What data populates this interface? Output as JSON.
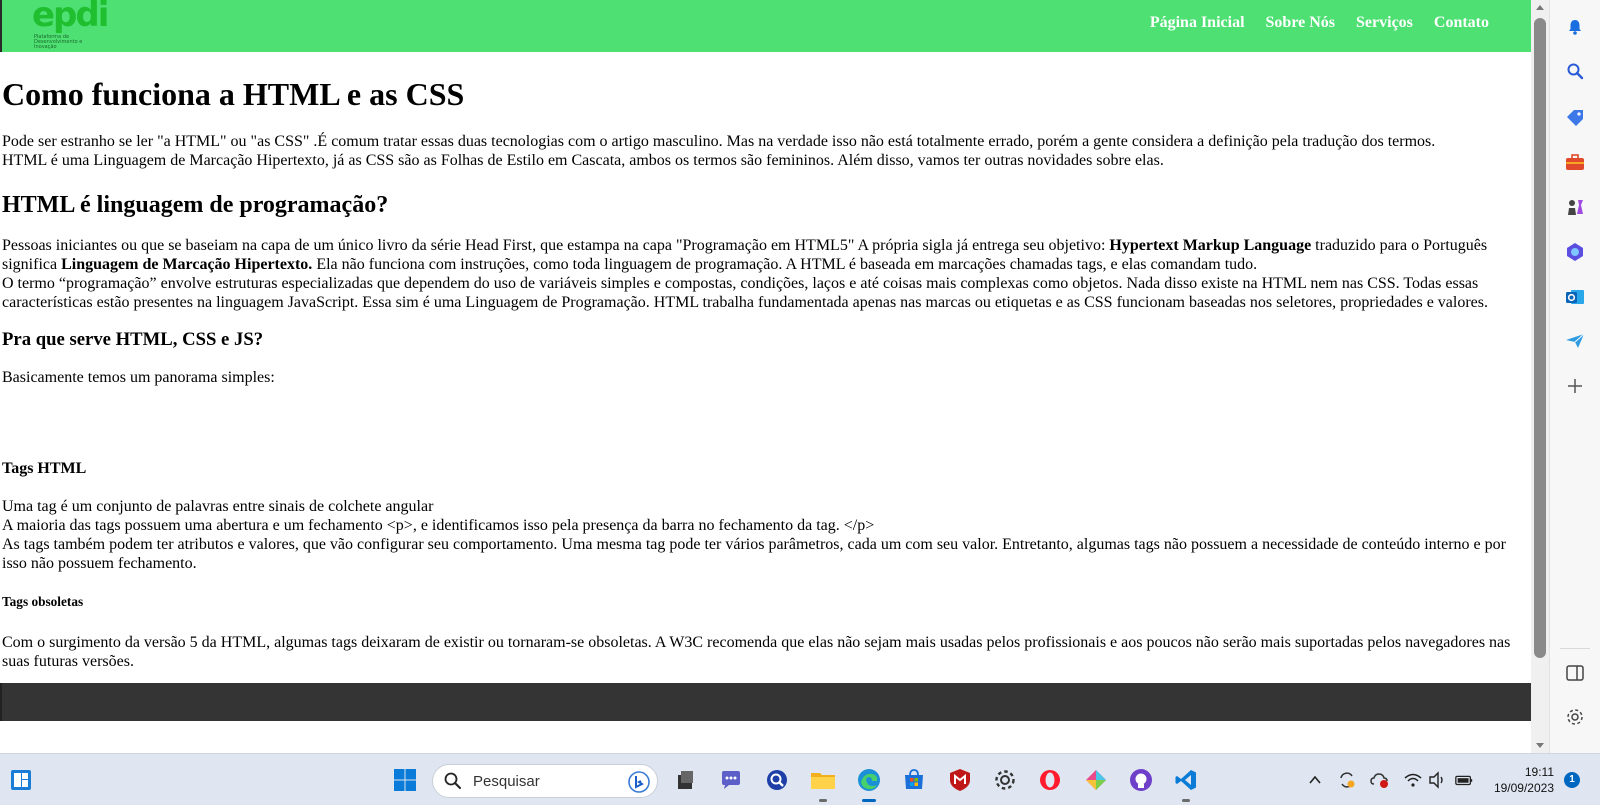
{
  "site": {
    "logo_text": "epdi",
    "logo_subtext": "Plataforma de Desenvolvimento e Inovação",
    "nav": [
      "Página Inicial",
      "Sobre Nós",
      "Serviços",
      "Contato"
    ]
  },
  "article": {
    "h1": "Como funciona a HTML e as CSS",
    "intro": [
      "Pode ser estranho se ler \"a HTML\" ou \"as CSS\" .É comum tratar essas duas tecnologias com o artigo masculino. Mas na verdade isso não está totalmente errado, porém a gente considera a definição pela tradução dos termos.",
      "HTML é uma Linguagem de Marcação Hipertexto, já as CSS são as Folhas de Estilo em Cascata, ambos os termos são femininos. Além disso, vamos ter outras novidades sobre elas."
    ],
    "h2": "HTML é linguagem de programação?",
    "p2_part1": "Pessoas iniciantes ou que se baseiam na capa de um único livro da série Head First, que estampa na capa \"Programação em HTML5\" A própria sigla já entrega seu objetivo: ",
    "p2_bold1": "Hypertext Markup Language",
    "p2_part2": " traduzido para o Português significa ",
    "p2_bold2": "Linguagem de Marcação Hipertexto.",
    "p2_part3": " Ela não funciona com instruções, como toda linguagem de programação. A HTML é baseada em marcações chamadas tags, e elas comandam tudo.",
    "p2_line2": "O termo “programação” envolve estruturas especializadas que dependem do uso de variáveis simples e compostas, condições, laços e até coisas mais complexas como objetos. Nada disso existe na HTML nem nas CSS. Todas essas características estão presentes na linguagem JavaScript. Essa sim é uma Linguagem de Programação. HTML trabalha fundamentada apenas nas marcas ou etiquetas e as CSS funcionam baseadas nos seletores, propriedades e valores.",
    "h3": "Pra que serve HTML, CSS e JS?",
    "p3": "Basicamente temos um panorama simples:",
    "h4": "Tags HTML",
    "p4": [
      "Uma tag é um conjunto de palavras entre sinais de colchete angular",
      "A maioria das tags possuem uma abertura e um fechamento <p>, e identificamos isso pela presença da barra no fechamento da tag. </p>",
      "As tags também podem ter atributos e valores, que vão configurar seu comportamento. Uma mesma tag pode ter vários parâmetros, cada um com seu valor. Entretanto, algumas tags não possuem a necessidade de conteúdo interno e por isso não possuem fechamento."
    ],
    "h5": "Tags obsoletas",
    "p5": "Com o surgimento da versão 5 da HTML, algumas tags deixaram de existir ou tornaram-se obsoletas. A W3C recomenda que elas não sejam mais usadas pelos profissionais e aos poucos não serão mais suportadas pelos navegadores nas suas futuras versões."
  },
  "sidebar": {
    "icons": [
      "bell-icon",
      "search-icon",
      "tag-icon",
      "toolbox-icon",
      "chess-icon",
      "copilot-icon",
      "outlook-icon",
      "send-icon",
      "plus-icon",
      "panel-icon",
      "settings-icon"
    ]
  },
  "taskbar": {
    "search_placeholder": "Pesquisar",
    "time": "19:11",
    "date": "19/09/2023",
    "notification_count": "1"
  },
  "colors": {
    "header_bg": "#4fe074",
    "footer_bg": "#343434",
    "taskbar_bg": "#dfe6f1",
    "accent": "#0067c0"
  }
}
